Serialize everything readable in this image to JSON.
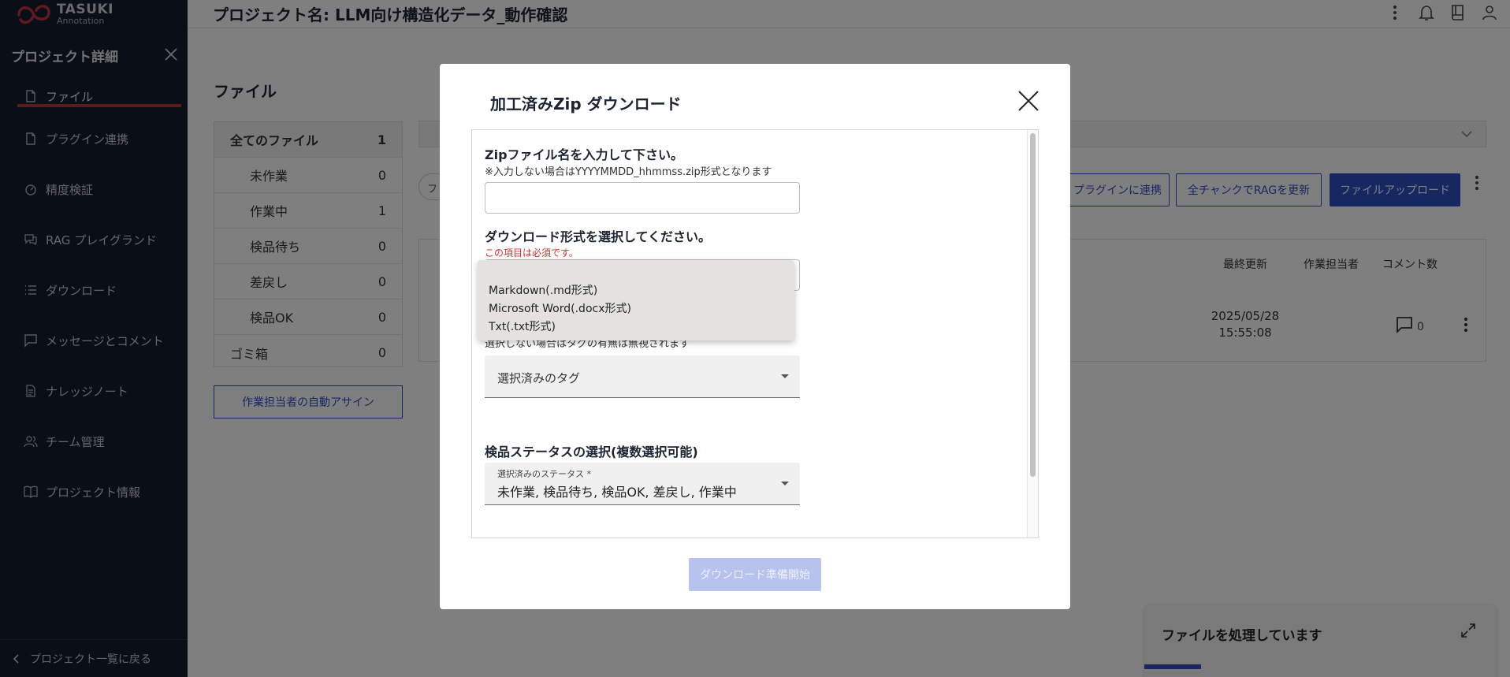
{
  "app": {
    "logo_line1": "TASUKI",
    "logo_line2": "Annotation",
    "project_title": "プロジェクト名: LLM向け構造化データ_動作確認"
  },
  "sidebar": {
    "title": "プロジェクト詳細",
    "items": [
      {
        "label": "ファイル",
        "icon": "file-icon",
        "active": true
      },
      {
        "label": "プラグイン連携",
        "icon": "document-icon"
      },
      {
        "label": "精度検証",
        "icon": "gauge-icon"
      },
      {
        "label": "RAG プレイグランド",
        "icon": "chat-icon"
      },
      {
        "label": "ダウンロード",
        "icon": "list-icon"
      },
      {
        "label": "メッセージとコメント",
        "icon": "message-icon"
      },
      {
        "label": "ナレッジノート",
        "icon": "note-icon"
      },
      {
        "label": "チーム管理",
        "icon": "team-icon"
      },
      {
        "label": "プロジェクト情報",
        "icon": "book-icon"
      }
    ],
    "back_label": "プロジェクト一覧に戻る"
  },
  "main": {
    "section_title": "ファイル",
    "file_groups": [
      {
        "label": "全てのファイル",
        "count": "1"
      },
      {
        "label": "未作業",
        "count": "0"
      },
      {
        "label": "作業中",
        "count": "1"
      },
      {
        "label": "検品待ち",
        "count": "0"
      },
      {
        "label": "差戻し",
        "count": "0"
      },
      {
        "label": "検品OK",
        "count": "0"
      },
      {
        "label": "ゴミ箱",
        "count": "0"
      }
    ],
    "auto_assign_label": "作業担当者の自動アサイン",
    "chip_label": "フ",
    "buttons": {
      "plugin": "プラグインに連携",
      "rag_update": "全チャンクでRAGを更新",
      "upload": "ファイルアップロード"
    },
    "table": {
      "headers": {
        "updated": "最終更新",
        "assignee": "作業担当者",
        "comments": "コメント数"
      },
      "rows": [
        {
          "updated_date": "2025/05/28",
          "updated_time": "15:55:08",
          "comment_count": "0"
        }
      ]
    }
  },
  "toast": {
    "text": "ファイルを処理しています",
    "progress": 0.16
  },
  "modal": {
    "title": "加工済みZip ダウンロード",
    "zip_label": "Zipファイル名を入力して下さい。",
    "zip_note": "※入力しない場合はYYYYMMDD_hhmmss.zip形式となります",
    "zip_value": "",
    "format_label": "ダウンロード形式を選択してください。",
    "format_error": "この項目は必須です。",
    "format_options": [
      "Markdown(.md形式)",
      "Microsoft Word(.docx形式)",
      "Txt(.txt形式)"
    ],
    "tag_note": "選択しない場合はタグの有無は無視されます",
    "tag_placeholder": "選択済みのタグ",
    "status_label": "検品ステータスの選択(複数選択可能)",
    "status_field_label": "選択済みのステータス *",
    "status_value": "未作業, 検品待ち, 検品OK, 差戻し, 作業中",
    "download_button": "ダウンロード準備開始"
  },
  "colors": {
    "sidebar_bg": "#141d2e",
    "accent": "#2d4fc4",
    "active_underline": "#b8343b",
    "error": "#d32f2f"
  }
}
